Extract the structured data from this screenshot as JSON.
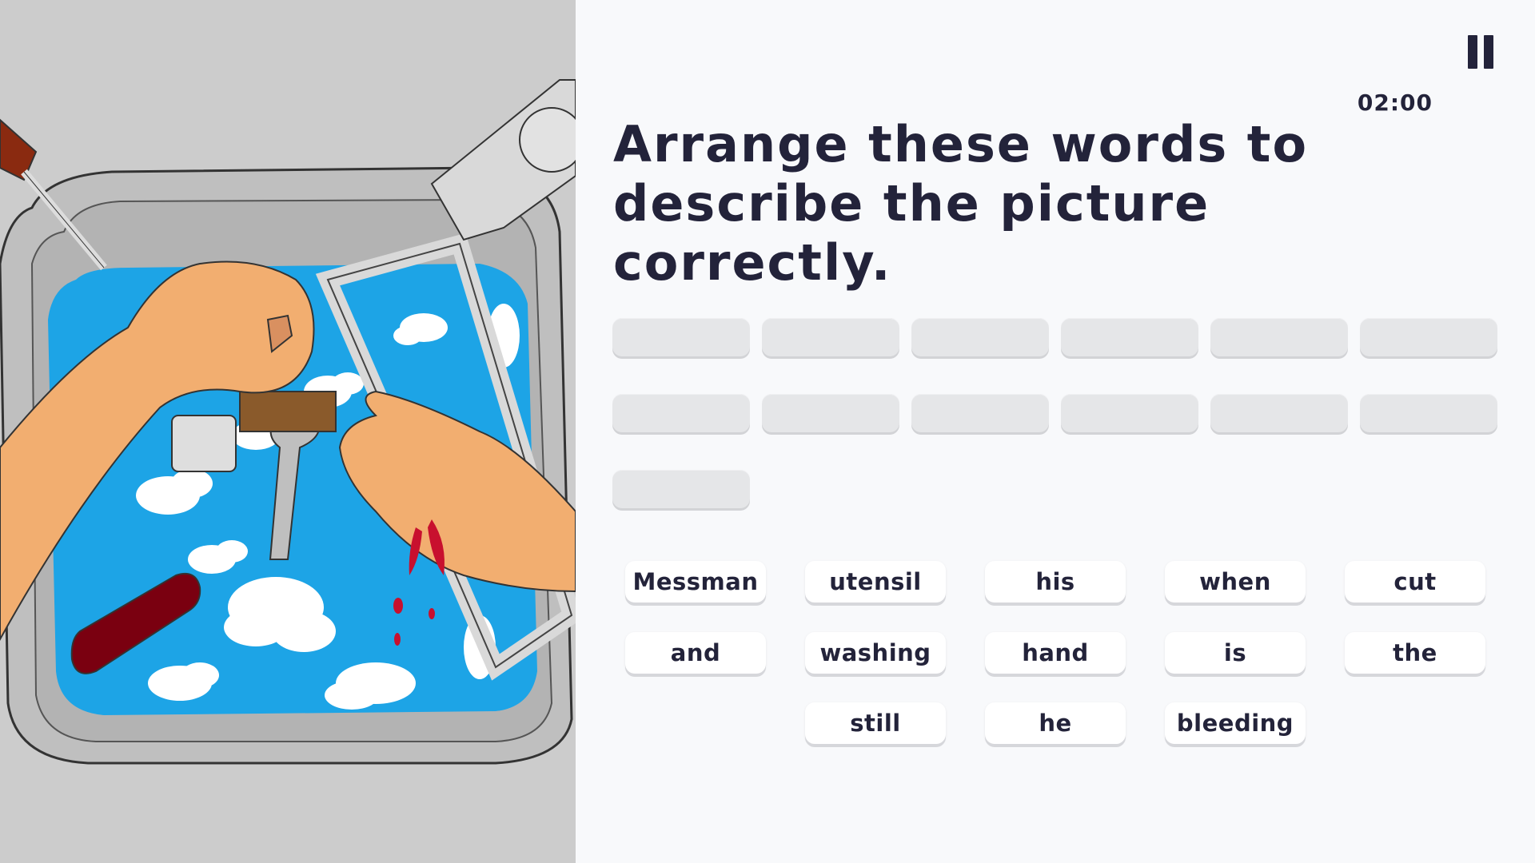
{
  "game": {
    "timer": "02:00",
    "instruction": "Arrange these words to describe the picture correctly.",
    "answer_slots": [
      {
        "value": ""
      },
      {
        "value": ""
      },
      {
        "value": ""
      },
      {
        "value": ""
      },
      {
        "value": ""
      },
      {
        "value": ""
      },
      {
        "value": ""
      },
      {
        "value": ""
      },
      {
        "value": ""
      },
      {
        "value": ""
      },
      {
        "value": ""
      },
      {
        "value": ""
      },
      {
        "value": ""
      }
    ],
    "word_bank": [
      "Messman",
      "utensil",
      "his",
      "when",
      "cut",
      "and",
      "washing",
      "hand",
      "is",
      "the",
      "still",
      "he",
      "bleeding"
    ]
  },
  "controls": {
    "pause_icon": "pause-icon"
  },
  "colors": {
    "text": "#23233a",
    "background": "#f8f9fb",
    "slot": "#e5e6e8",
    "word_tile": "#ffffff",
    "water": "#1da4e6",
    "skin": "#f2ae70",
    "blood": "#c8102e"
  }
}
